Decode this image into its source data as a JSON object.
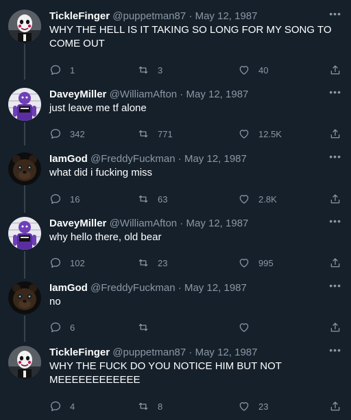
{
  "tweets": [
    {
      "name": "TickleFinger",
      "handle": "@puppetman87",
      "date": "May 12, 1987",
      "text": "WHY THE HELL IS IT TAKING SO LONG FOR MY SONG TO COME OUT",
      "replies": "1",
      "retweets": "3",
      "likes": "40",
      "avatar": "puppet-avatar"
    },
    {
      "name": "DaveyMiller",
      "handle": "@WilliamAfton",
      "date": "May 12, 1987",
      "text": "just leave me tf alone",
      "replies": "342",
      "retweets": "771",
      "likes": "12.5K",
      "avatar": "purple-guy-avatar"
    },
    {
      "name": "IamGod",
      "handle": "@FreddyFuckman",
      "date": "May 12, 1987",
      "text": "what did i fucking miss",
      "replies": "16",
      "retweets": "63",
      "likes": "2.8K",
      "avatar": "freddy-avatar"
    },
    {
      "name": "DaveyMiller",
      "handle": "@WilliamAfton",
      "date": "May 12, 1987",
      "text": "why hello there, old bear",
      "replies": "102",
      "retweets": "23",
      "likes": "995",
      "avatar": "purple-guy-avatar"
    },
    {
      "name": "IamGod",
      "handle": "@FreddyFuckman",
      "date": "May 12, 1987",
      "text": "no",
      "replies": "6",
      "retweets": "",
      "likes": "",
      "avatar": "freddy-avatar"
    },
    {
      "name": "TickleFinger",
      "handle": "@puppetman87",
      "date": "May 12, 1987",
      "text": "WHY THE FUCK DO YOU NOTICE HIM BUT NOT MEEEEEEEEEEEE",
      "replies": "4",
      "retweets": "8",
      "likes": "23",
      "avatar": "puppet-avatar"
    }
  ],
  "separator": " · ",
  "more_icon": "more-icon",
  "colors": {
    "background": "#15202b",
    "secondary_text": "#8b98a5",
    "thread_line": "#38444d"
  }
}
